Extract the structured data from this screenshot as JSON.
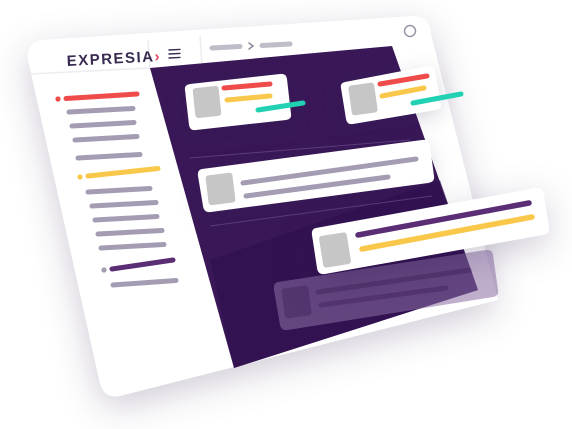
{
  "app": {
    "logo_text": "EXPRESIA",
    "logo_mark": "›"
  },
  "icons": {
    "menu": "hamburger-menu-icon",
    "breadcrumb_separator": "chevron-right-icon",
    "profile": "user-avatar-icon"
  },
  "colors": {
    "primary_purple": "#3a1858",
    "deep_purple": "#2e0f4e",
    "accent_red": "#ef4b4b",
    "accent_yellow": "#f9c84a",
    "accent_teal": "#21d1b3",
    "bar_gray": "#a49cb2",
    "thumb_gray": "#c6c6c6",
    "dark_purple_bar": "#5a2d75",
    "logo_dark": "#3a2a52",
    "logo_accent": "#e2445c"
  },
  "sidebar": {
    "groups": [
      {
        "bullet_color": "#ef4b4b",
        "accent": "red"
      },
      {
        "bullet_color": "#f9c84a",
        "accent": "yellow"
      },
      {
        "bullet_color": "#a49cb2",
        "accent": "purple"
      }
    ]
  }
}
